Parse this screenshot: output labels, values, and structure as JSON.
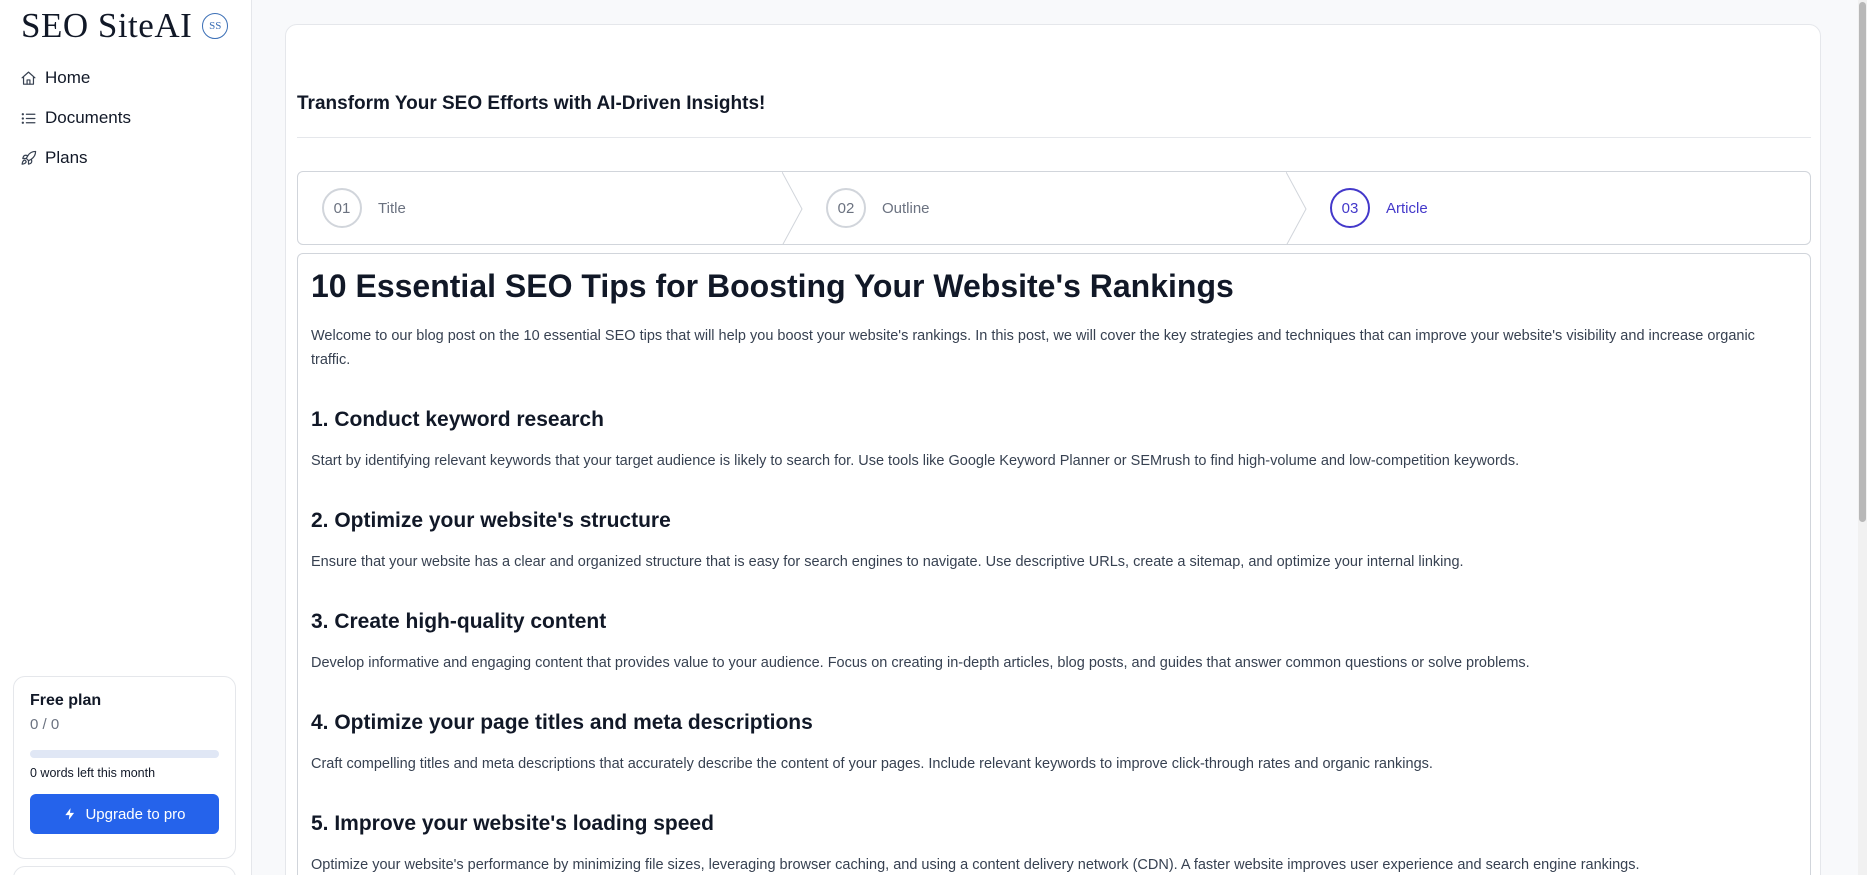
{
  "brand": {
    "name": "SEO SiteAI",
    "badge": "SS"
  },
  "nav": [
    {
      "label": "Home",
      "icon": "home-icon"
    },
    {
      "label": "Documents",
      "icon": "list-icon"
    },
    {
      "label": "Plans",
      "icon": "rocket-icon"
    }
  ],
  "plan": {
    "title": "Free plan",
    "count": "0 / 0",
    "progress": 0,
    "words_left": "0 words left this month",
    "upgrade_label": "Upgrade to pro"
  },
  "main": {
    "title": "Transform Your SEO Efforts with AI-Driven Insights!",
    "steps": [
      {
        "number": "01",
        "label": "Title",
        "active": false
      },
      {
        "number": "02",
        "label": "Outline",
        "active": false
      },
      {
        "number": "03",
        "label": "Article",
        "active": true
      }
    ]
  },
  "article": {
    "heading": "10 Essential SEO Tips for Boosting Your Website's Rankings",
    "intro": "Welcome to our blog post on the 10 essential SEO tips that will help you boost your website's rankings. In this post, we will cover the key strategies and techniques that can improve your website's visibility and increase organic traffic.",
    "sections": [
      {
        "heading": "1. Conduct keyword research",
        "body": "Start by identifying relevant keywords that your target audience is likely to search for. Use tools like Google Keyword Planner or SEMrush to find high-volume and low-competition keywords."
      },
      {
        "heading": "2. Optimize your website's structure",
        "body": "Ensure that your website has a clear and organized structure that is easy for search engines to navigate. Use descriptive URLs, create a sitemap, and optimize your internal linking."
      },
      {
        "heading": "3. Create high-quality content",
        "body": "Develop informative and engaging content that provides value to your audience. Focus on creating in-depth articles, blog posts, and guides that answer common questions or solve problems."
      },
      {
        "heading": "4. Optimize your page titles and meta descriptions",
        "body": "Craft compelling titles and meta descriptions that accurately describe the content of your pages. Include relevant keywords to improve click-through rates and organic rankings."
      },
      {
        "heading": "5. Improve your website's loading speed",
        "body": "Optimize your website's performance by minimizing file sizes, leveraging browser caching, and using a content delivery network (CDN). A faster website improves user experience and search engine rankings."
      }
    ]
  },
  "colors": {
    "accent": "#2563eb",
    "step_active": "#4338ca",
    "border": "#d1d5db"
  }
}
